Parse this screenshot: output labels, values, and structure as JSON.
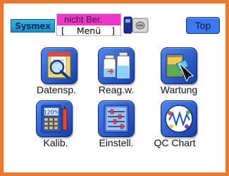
{
  "header": {
    "logo_text": "Sysmex",
    "status_label": "nicht Ber.",
    "menu_bracket_left": "[",
    "menu_label": "Menü",
    "menu_bracket_right": "]",
    "top_button_label": "Top"
  },
  "tiles": [
    {
      "label": "Datensp.",
      "icon": "magnifier-folder-icon"
    },
    {
      "label": "Reag.w.",
      "icon": "reagent-bottles-icon"
    },
    {
      "label": "Wartung",
      "icon": "maintenance-icon"
    },
    {
      "label": "Kalib.",
      "icon": "calibration-icon"
    },
    {
      "label": "Einstell.",
      "icon": "settings-icon"
    },
    {
      "label": "QC Chart",
      "icon": "qc-chart-icon"
    }
  ],
  "calibration_icon_text": "120%",
  "colors": {
    "frame_border": "#e87a2e",
    "status_bar": "#ef38c9",
    "button_blue": "#3f78ee",
    "logo_blue": "#1f8fc4"
  }
}
